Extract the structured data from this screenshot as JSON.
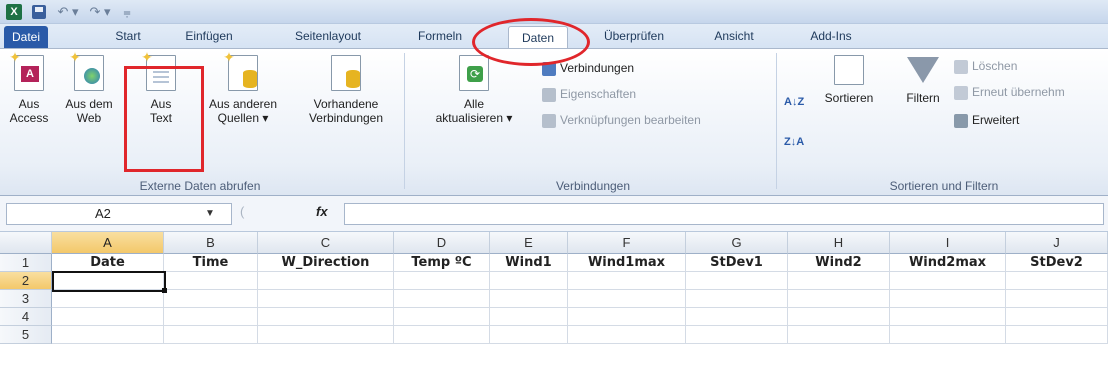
{
  "qat": {
    "logo_letter": "X",
    "undo_glyph": "↶ ▾",
    "redo_glyph": "↷ ▾",
    "customize_glyph": "⩦"
  },
  "tabs": [
    "Datei",
    "Start",
    "Einfügen",
    "Seitenlayout",
    "Formeln",
    "Daten",
    "Überprüfen",
    "Ansicht",
    "Add-Ins"
  ],
  "groups": {
    "external": {
      "label": "Externe Daten abrufen",
      "buttons": [
        {
          "line1": "Aus",
          "line2": "Access"
        },
        {
          "line1": "Aus dem",
          "line2": "Web"
        },
        {
          "line1": "Aus",
          "line2": "Text"
        },
        {
          "line1": "Aus anderen",
          "line2": "Quellen ▾"
        },
        {
          "line1": "Vorhandene",
          "line2": "Verbindungen"
        }
      ]
    },
    "connections": {
      "label": "Verbindungen",
      "refresh_line1": "Alle",
      "refresh_line2": "aktualisieren ▾",
      "items": [
        "Verbindungen",
        "Eigenschaften",
        "Verknüpfungen bearbeiten"
      ]
    },
    "sort": {
      "label": "Sortieren und Filtern",
      "sort_az": "A↓Z",
      "sort_za": "Z↓A",
      "sort_label": "Sortieren",
      "filter_label": "Filtern",
      "clear": "Löschen",
      "reapply": "Erneut übernehm",
      "advanced": "Erweitert"
    }
  },
  "formula_bar": {
    "cell_ref": "A2",
    "fx": "fx",
    "value": ""
  },
  "grid": {
    "columns": [
      "A",
      "B",
      "C",
      "D",
      "E",
      "F",
      "G",
      "H",
      "I",
      "J"
    ],
    "rows": [
      "1",
      "2",
      "3",
      "4",
      "5"
    ],
    "header_row": [
      "Date",
      "Time",
      "W_Direction",
      "Temp ºC",
      "Wind1",
      "Wind1max",
      "StDev1",
      "Wind2",
      "Wind2max",
      "StDev2"
    ],
    "selected_cell": "A2"
  },
  "colors": {
    "accent": "#2a5aa8",
    "annotation": "#e0262b",
    "selection": "#f3c86a"
  }
}
